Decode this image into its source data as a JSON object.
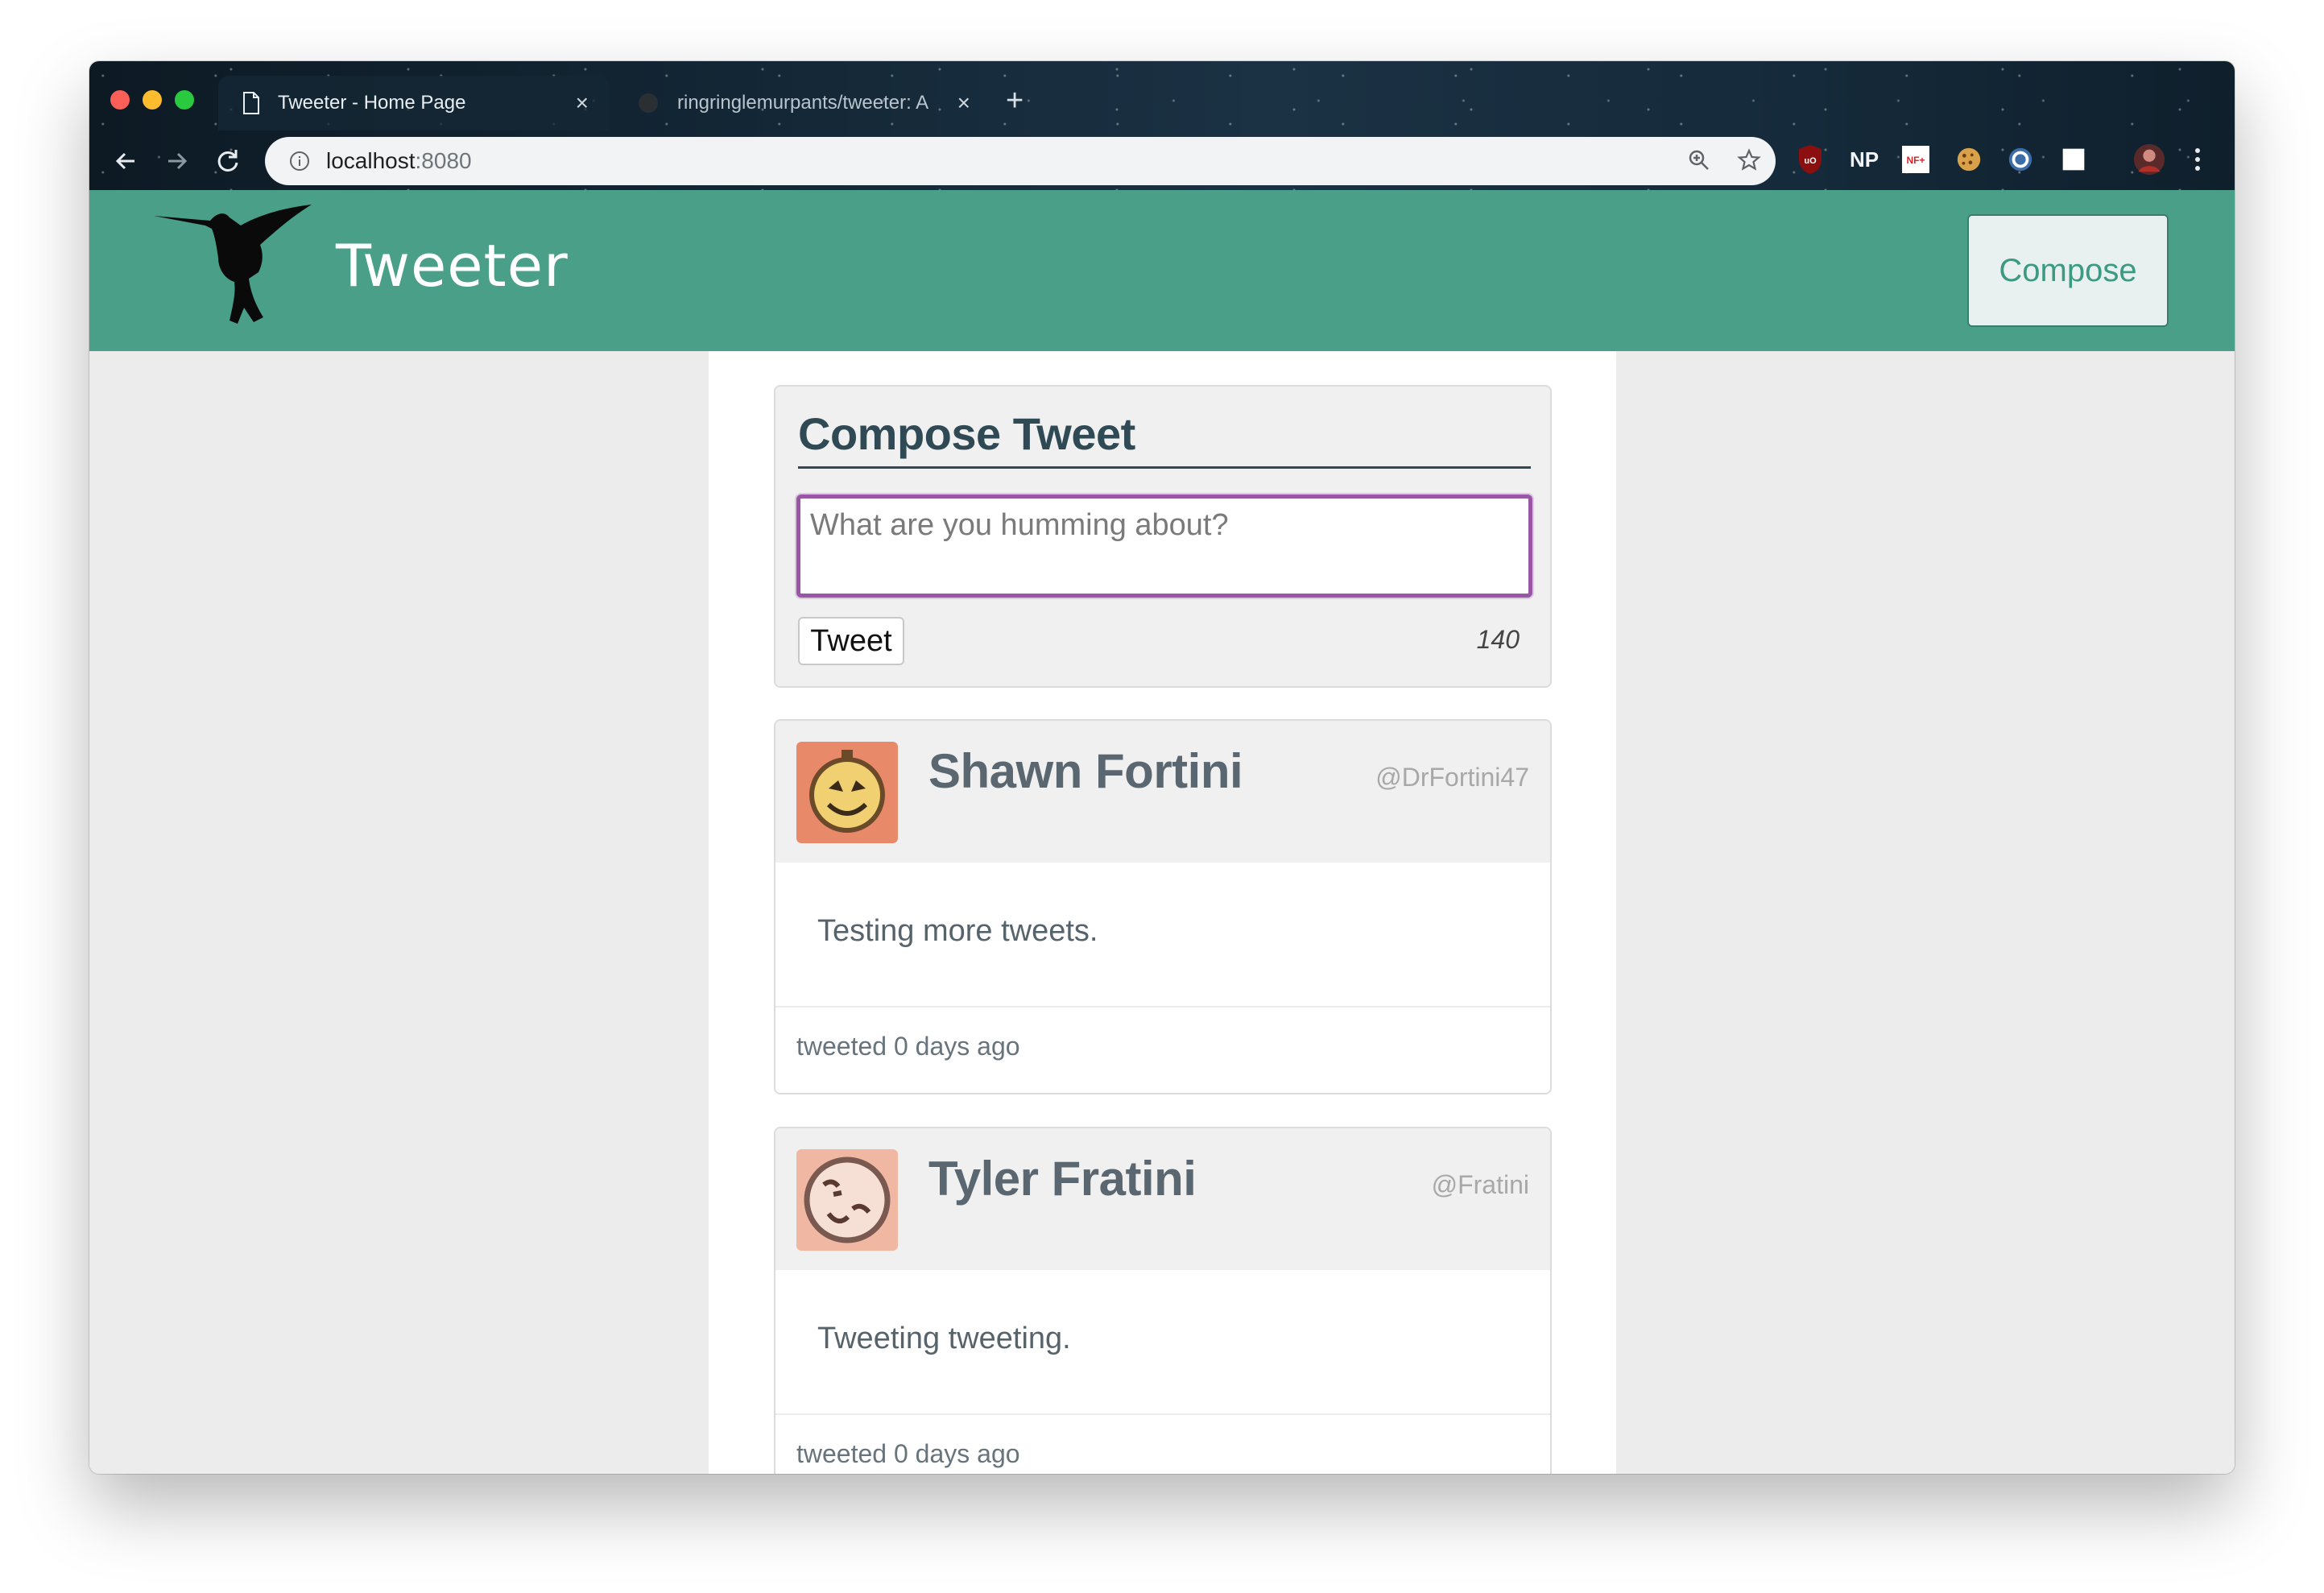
{
  "browser": {
    "tabs": [
      {
        "title": "Tweeter - Home Page",
        "active": true
      },
      {
        "title": "ringringlemurpants/tweeter: A",
        "active": false
      }
    ],
    "url_host": "localhost",
    "url_port": ":8080",
    "extensions": [
      "ublock-icon",
      "np-icon",
      "nf-icon",
      "cookie-icon",
      "circle-icon",
      "square-icon"
    ],
    "extension_np_label": "NP",
    "extension_nf_label": "NF+",
    "extension_ublock_label": "uO"
  },
  "header": {
    "brand": "Tweeter",
    "compose_label": "Compose",
    "color": "#4a9f88"
  },
  "compose": {
    "title": "Compose Tweet",
    "placeholder": "What are you humming about?",
    "button_label": "Tweet",
    "char_count": "140",
    "focus_color": "#9a56a6"
  },
  "tweets": [
    {
      "name": "Shawn Fortini",
      "handle": "@DrFortini47",
      "content": "Testing more tweets.",
      "time": "tweeted 0 days ago",
      "avatar_color": "#e8896a"
    },
    {
      "name": "Tyler Fratini",
      "handle": "@Fratini",
      "content": "Tweeting tweeting.",
      "time": "tweeted 0 days ago",
      "avatar_color": "#f0b8a2"
    }
  ]
}
